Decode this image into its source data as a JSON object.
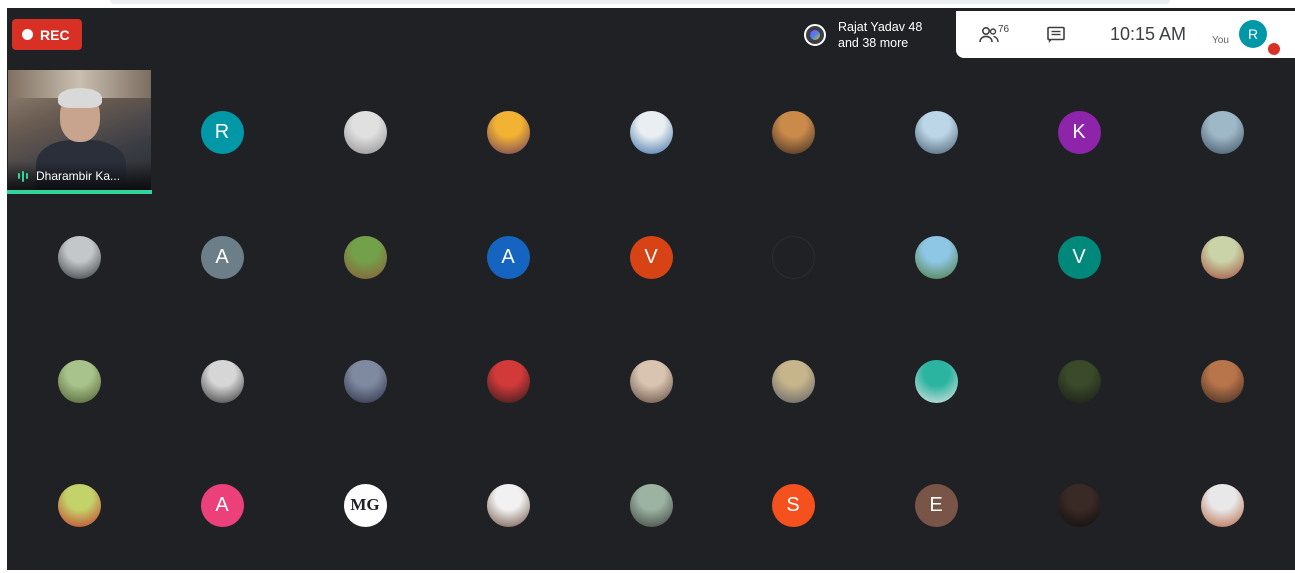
{
  "rec": {
    "label": "REC",
    "color": "#d93025"
  },
  "joiners": {
    "line1": "Rajat Yadav 48",
    "line2": "and 38 more"
  },
  "toolbar": {
    "people_count": "76",
    "time": "10:15 AM",
    "you_label": "You",
    "self_initial": "R"
  },
  "featured": {
    "name": "Dharambir Ka..."
  },
  "tiles": [
    {
      "row": 0,
      "col": 1,
      "kind": "letter",
      "text": "R",
      "color": "#0097a7"
    },
    {
      "row": 0,
      "col": 2,
      "kind": "photo",
      "colors": [
        "#e0e0e0",
        "#8d8d8d"
      ]
    },
    {
      "row": 0,
      "col": 3,
      "kind": "photo",
      "colors": [
        "#f2b233",
        "#6a3b5e"
      ]
    },
    {
      "row": 0,
      "col": 4,
      "kind": "photo",
      "colors": [
        "#e9eef2",
        "#3a6ea5"
      ]
    },
    {
      "row": 0,
      "col": 5,
      "kind": "photo",
      "colors": [
        "#c98a4a",
        "#3a2a22"
      ]
    },
    {
      "row": 0,
      "col": 6,
      "kind": "photo",
      "colors": [
        "#bcd6e8",
        "#445a6b"
      ]
    },
    {
      "row": 0,
      "col": 7,
      "kind": "letter",
      "text": "K",
      "color": "#8e24aa"
    },
    {
      "row": 0,
      "col": 8,
      "kind": "photo",
      "colors": [
        "#9fb8c8",
        "#3e5063"
      ]
    },
    {
      "row": 1,
      "col": 0,
      "kind": "photo",
      "colors": [
        "#c4c7c9",
        "#30353a"
      ]
    },
    {
      "row": 1,
      "col": 1,
      "kind": "letter",
      "text": "A",
      "color": "#6c7f89"
    },
    {
      "row": 1,
      "col": 2,
      "kind": "photo",
      "colors": [
        "#73a04a",
        "#8a5a38"
      ]
    },
    {
      "row": 1,
      "col": 3,
      "kind": "letter",
      "text": "A",
      "color": "#1565c0"
    },
    {
      "row": 1,
      "col": 4,
      "kind": "letter",
      "text": "V",
      "color": "#d84315"
    },
    {
      "row": 1,
      "col": 5,
      "kind": "empty"
    },
    {
      "row": 1,
      "col": 6,
      "kind": "photo",
      "colors": [
        "#8ec6e6",
        "#4d7a3a"
      ]
    },
    {
      "row": 1,
      "col": 7,
      "kind": "letter",
      "text": "V",
      "color": "#00897b"
    },
    {
      "row": 1,
      "col": 8,
      "kind": "photo",
      "colors": [
        "#c9d3a7",
        "#a34b3b"
      ]
    },
    {
      "row": 2,
      "col": 0,
      "kind": "photo",
      "colors": [
        "#a8c38b",
        "#4c5b2f"
      ]
    },
    {
      "row": 2,
      "col": 1,
      "kind": "photo",
      "colors": [
        "#d6d6d6",
        "#333333"
      ]
    },
    {
      "row": 2,
      "col": 2,
      "kind": "photo",
      "colors": [
        "#7f8aa0",
        "#2a2f45"
      ]
    },
    {
      "row": 2,
      "col": 3,
      "kind": "photo",
      "colors": [
        "#d23a3a",
        "#2a1a1a"
      ]
    },
    {
      "row": 2,
      "col": 4,
      "kind": "photo",
      "colors": [
        "#d9c3b1",
        "#5d4a3e"
      ]
    },
    {
      "row": 2,
      "col": 5,
      "kind": "photo",
      "colors": [
        "#c6b48a",
        "#5c5f66"
      ]
    },
    {
      "row": 2,
      "col": 6,
      "kind": "photo",
      "colors": [
        "#2bb4a0",
        "#e7e7e7"
      ]
    },
    {
      "row": 2,
      "col": 7,
      "kind": "photo",
      "colors": [
        "#3a4a2a",
        "#1a1a1a"
      ]
    },
    {
      "row": 2,
      "col": 8,
      "kind": "photo",
      "colors": [
        "#b8744a",
        "#3b2a22"
      ]
    },
    {
      "row": 3,
      "col": 0,
      "kind": "photo",
      "colors": [
        "#c4d26a",
        "#c0392b"
      ]
    },
    {
      "row": 3,
      "col": 1,
      "kind": "letter",
      "text": "A",
      "color": "#ec407a"
    },
    {
      "row": 3,
      "col": 2,
      "kind": "mg",
      "text": "MG"
    },
    {
      "row": 3,
      "col": 3,
      "kind": "photo",
      "colors": [
        "#f1f1f1",
        "#6b4f3f"
      ]
    },
    {
      "row": 3,
      "col": 4,
      "kind": "photo",
      "colors": [
        "#9cb3a2",
        "#3a3f3a"
      ]
    },
    {
      "row": 3,
      "col": 5,
      "kind": "letter",
      "text": "S",
      "color": "#f4511e"
    },
    {
      "row": 3,
      "col": 6,
      "kind": "letter",
      "text": "E",
      "color": "#795548"
    },
    {
      "row": 3,
      "col": 7,
      "kind": "photo",
      "colors": [
        "#3a2a26",
        "#0d0d0d"
      ]
    },
    {
      "row": 3,
      "col": 8,
      "kind": "photo",
      "colors": [
        "#e8e8e8",
        "#b4623f"
      ]
    }
  ]
}
